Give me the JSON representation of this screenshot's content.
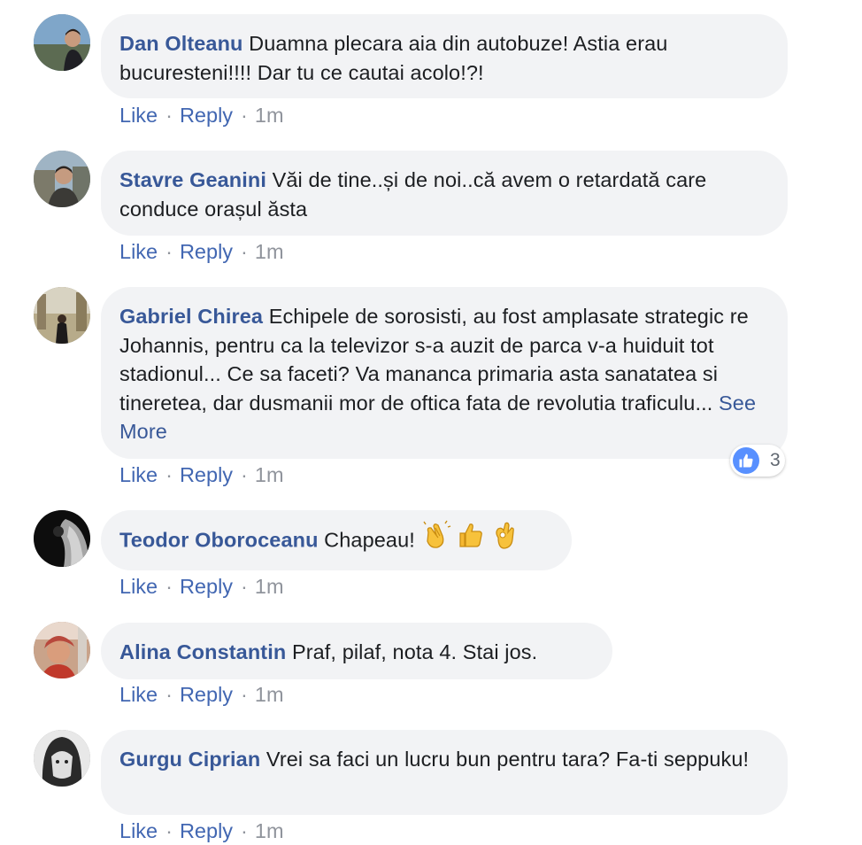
{
  "theme": {
    "author_color": "#385898",
    "link_color": "#4267b2",
    "bubble_bg": "#f2f3f5",
    "meta_color": "#90949c",
    "like_badge_color": "#5890ff"
  },
  "comments": [
    {
      "author": "Dan Olteanu",
      "text": "Duamna plecara aia din autobuze! Astia erau bucuresteni!!!! Dar tu ce cautai acolo!?!",
      "like_label": "Like",
      "reply_label": "Reply",
      "time": "1m"
    },
    {
      "author": "Stavre Geanini",
      "text": "Văi de tine..și de noi..că avem o retardată care conduce orașul ăsta",
      "like_label": "Like",
      "reply_label": "Reply",
      "time": "1m"
    },
    {
      "author": "Gabriel Chirea",
      "text": "Echipele de sorosisti, au fost amplasate strategic re Johannis, pentru ca la televizor s-a auzit de parca v-a huiduit tot stadionul... Ce sa faceti? Va mananca primaria asta sanatatea si tineretea, dar dusmanii mor de oftica fata de revolutia traficulu...",
      "see_more": "See More",
      "reaction_icon": "thumbs-up-icon",
      "reaction_count": "3",
      "like_label": "Like",
      "reply_label": "Reply",
      "time": "1m"
    },
    {
      "author": "Teodor Oboroceanu",
      "text": "Chapeau!",
      "emojis": [
        "clapping-hands-icon",
        "thumbs-up-icon",
        "ok-hand-icon"
      ],
      "like_label": "Like",
      "reply_label": "Reply",
      "time": "1m"
    },
    {
      "author": "Alina Constantin",
      "text": "Praf, pilaf, nota 4. Stai jos.",
      "like_label": "Like",
      "reply_label": "Reply",
      "time": "1m"
    },
    {
      "author": "Gurgu Ciprian",
      "text": "Vrei sa faci un lucru bun pentru tara? Fa-ti seppuku!",
      "like_label": "Like",
      "reply_label": "Reply",
      "time": "1m"
    }
  ],
  "separator": "·"
}
